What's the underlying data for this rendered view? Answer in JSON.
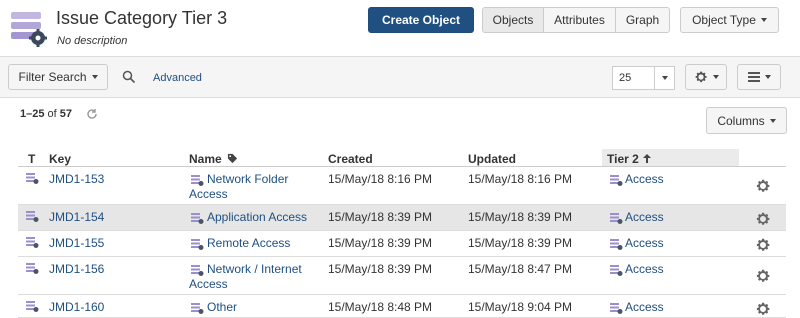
{
  "header": {
    "title": "Issue Category Tier 3",
    "description": "No description",
    "icon": "object-type-icon",
    "create_label": "Create Object",
    "views": [
      "Objects",
      "Attributes",
      "Graph"
    ],
    "active_view": "Objects",
    "object_type_label": "Object Type"
  },
  "toolbar": {
    "filter_label": "Filter Search",
    "advanced_label": "Advanced",
    "page_size": "25"
  },
  "summary": {
    "range": "1–25",
    "of": "of",
    "total": "57"
  },
  "columns_label": "Columns",
  "table": {
    "headers": [
      "T",
      "Key",
      "Name",
      "Created",
      "Updated",
      "Tier 2"
    ],
    "rows": [
      {
        "key": "JMD1-153",
        "name1": "Network Folder",
        "name2": "Access",
        "created": "15/May/18 8:16 PM",
        "updated": "15/May/18 8:16 PM",
        "tier2": "Access"
      },
      {
        "key": "JMD1-154",
        "name1": "Application Access",
        "name2": "",
        "created": "15/May/18 8:39 PM",
        "updated": "15/May/18 8:39 PM",
        "tier2": "Access"
      },
      {
        "key": "JMD1-155",
        "name1": "Remote Access",
        "name2": "",
        "created": "15/May/18 8:39 PM",
        "updated": "15/May/18 8:39 PM",
        "tier2": "Access"
      },
      {
        "key": "JMD1-156",
        "name1": "Network / Internet",
        "name2": "Access",
        "created": "15/May/18 8:39 PM",
        "updated": "15/May/18 8:47 PM",
        "tier2": "Access"
      },
      {
        "key": "JMD1-160",
        "name1": "Other",
        "name2": "",
        "created": "15/May/18 8:48 PM",
        "updated": "15/May/18 9:04 PM",
        "tier2": "Access"
      }
    ]
  },
  "colors": {
    "primary": "#205081",
    "link": "#205081",
    "selected_row": "#e6e6e6"
  }
}
